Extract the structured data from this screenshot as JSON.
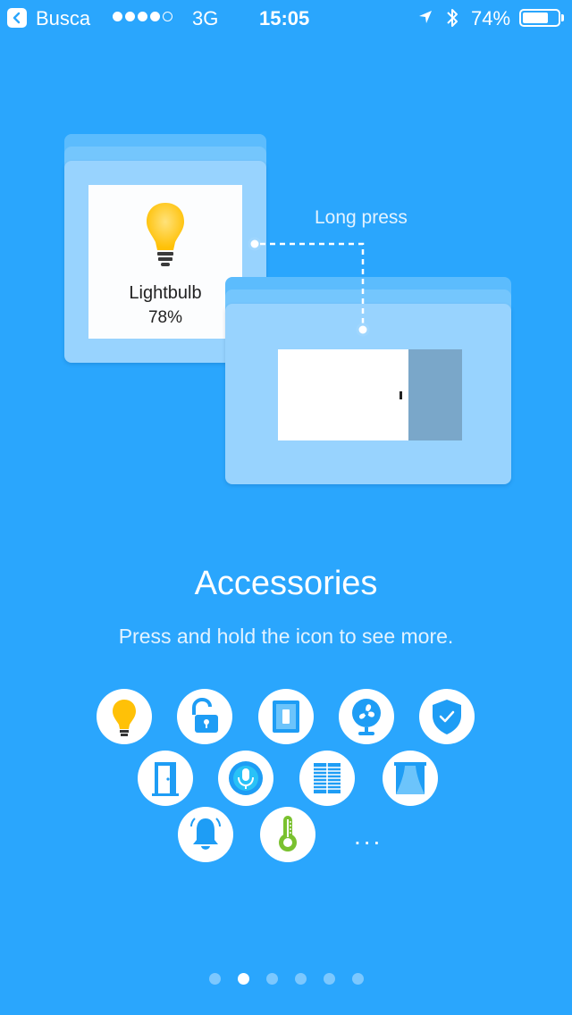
{
  "status_bar": {
    "back_app": "Busca",
    "signal_bars_filled": 4,
    "signal_bars_total": 5,
    "network": "3G",
    "time": "15:05",
    "battery_percent_label": "74%",
    "battery_level": 0.74,
    "icons": [
      "back-arrow-icon",
      "location-arrow-icon",
      "bluetooth-icon",
      "battery-icon"
    ]
  },
  "illustration": {
    "tile": {
      "icon": "lightbulb-icon",
      "name": "Lightbulb",
      "value": "78%"
    },
    "gesture_label": "Long press",
    "slider_level": 0.71
  },
  "intro": {
    "title": "Accessories",
    "subtitle": "Press and hold the icon to see more."
  },
  "accessories": {
    "icons": [
      "lightbulb-icon",
      "unlocked-lock-icon",
      "wall-switch-icon",
      "fan-icon",
      "security-shield-icon",
      "door-icon",
      "microphone-icon",
      "window-blinds-icon",
      "curtains-icon",
      "alarm-bell-icon",
      "thermometer-icon"
    ],
    "more": "..."
  },
  "pager": {
    "count": 6,
    "active_index": 1
  },
  "colors": {
    "background": "#2aa6fd",
    "card": "#98d3fe",
    "bulb_yellow": "#ffc107",
    "icon_blue": "#1e9df5",
    "thermometer_green": "#7ac12f"
  }
}
